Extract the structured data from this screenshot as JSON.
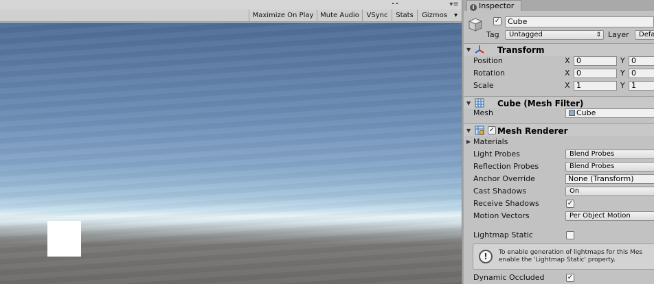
{
  "game_view": {
    "toolbar": {
      "maximize_on_play": "Maximize On Play",
      "mute_audio": "Mute Audio",
      "vsync": "VSync",
      "stats": "Stats",
      "gizmos": "Gizmos",
      "gizmos_arrow": "▾",
      "menu_icon": "▾≡"
    }
  },
  "inspector": {
    "tab_label": "Inspector",
    "object": {
      "active": true,
      "name": "Cube",
      "tag_label": "Tag",
      "tag_value": "Untagged",
      "tag_arrow": "⇕",
      "layer_label": "Layer",
      "layer_value": "Defa"
    },
    "transform": {
      "title": "Transform",
      "rows": [
        {
          "label": "Position",
          "x": "0",
          "y": "0"
        },
        {
          "label": "Rotation",
          "x": "0",
          "y": "0"
        },
        {
          "label": "Scale",
          "x": "1",
          "y": "1"
        }
      ]
    },
    "mesh_filter": {
      "title": "Cube (Mesh Filter)",
      "mesh_label": "Mesh",
      "mesh_value": "Cube"
    },
    "mesh_renderer": {
      "title": "Mesh Renderer",
      "enabled": true,
      "materials_label": "Materials",
      "light_probes_label": "Light Probes",
      "light_probes_value": "Blend Probes",
      "reflection_probes_label": "Reflection Probes",
      "reflection_probes_value": "Blend Probes",
      "anchor_override_label": "Anchor Override",
      "anchor_override_value": "None (Transform)",
      "cast_shadows_label": "Cast Shadows",
      "cast_shadows_value": "On",
      "receive_shadows_label": "Receive Shadows",
      "receive_shadows_checked": true,
      "motion_vectors_label": "Motion Vectors",
      "motion_vectors_value": "Per Object Motion",
      "lightmap_static_label": "Lightmap Static",
      "lightmap_static_checked": false,
      "help_line_1": "To enable generation of lightmaps for this Mes",
      "help_line_2": "enable the 'Lightmap Static' property.",
      "dynamic_occluded_label": "Dynamic Occluded",
      "dynamic_occluded_checked": true
    },
    "checkmark": "✓",
    "foldout_open": "▼",
    "foldout_closed": "▶",
    "help_icon": "!"
  },
  "colors": {
    "panel_bg": "#c2c2c2",
    "sky_top": "#4e6d96",
    "horizon": "#e6f3f7",
    "ground": "#6e6b69"
  }
}
